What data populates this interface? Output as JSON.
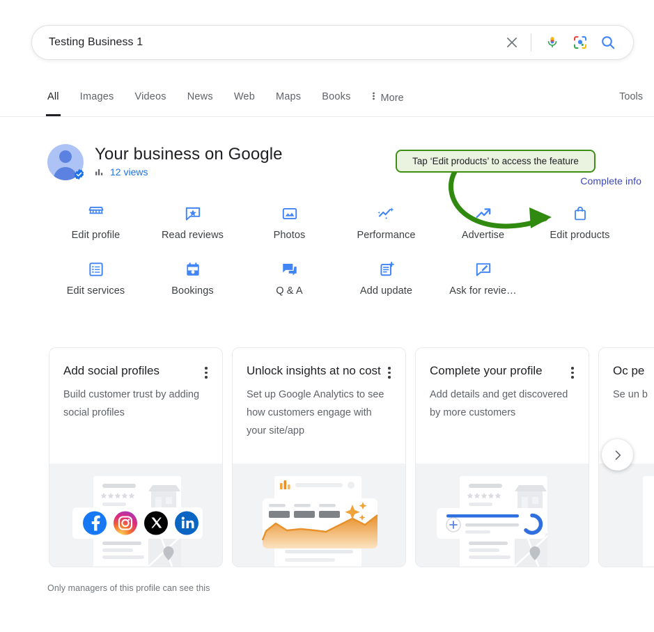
{
  "search": {
    "query": "Testing Business 1",
    "clear_icon": "close-icon",
    "mic_icon": "microphone-icon",
    "lens_icon": "google-lens-icon",
    "search_icon": "search-icon"
  },
  "nav": {
    "items": [
      {
        "label": "All",
        "active": true
      },
      {
        "label": "Images",
        "active": false
      },
      {
        "label": "Videos",
        "active": false
      },
      {
        "label": "News",
        "active": false
      },
      {
        "label": "Web",
        "active": false
      },
      {
        "label": "Maps",
        "active": false
      },
      {
        "label": "Books",
        "active": false
      }
    ],
    "more_label": "More",
    "more_icon": "vertical-dots-icon",
    "tools_label": "Tools"
  },
  "business": {
    "title": "Your business on Google",
    "views_text": "12 views",
    "views_icon": "bar-chart-icon",
    "avatar_icon": "person-avatar",
    "verified_icon": "verified-badge-icon",
    "complete_info_label": "Complete info"
  },
  "callout": {
    "text": "Tap ‘Edit products’ to access the feature",
    "border_color": "#3f8f15",
    "background_color": "#eaf3e0",
    "arrow_color": "#2f8a0f"
  },
  "actions": {
    "row1": [
      {
        "label": "Edit profile",
        "icon": "storefront-icon"
      },
      {
        "label": "Read reviews",
        "icon": "review-star-chat-icon"
      },
      {
        "label": "Photos",
        "icon": "photo-icon"
      },
      {
        "label": "Performance",
        "icon": "trending-sparkle-icon"
      },
      {
        "label": "Advertise",
        "icon": "trending-up-arrow-icon"
      },
      {
        "label": "Edit products",
        "icon": "shopping-bag-icon"
      }
    ],
    "row2": [
      {
        "label": "Edit services",
        "icon": "list-icon"
      },
      {
        "label": "Bookings",
        "icon": "calendar-icon"
      },
      {
        "label": "Q & A",
        "icon": "chat-bubbles-icon"
      },
      {
        "label": "Add update",
        "icon": "add-post-icon"
      },
      {
        "label": "Ask for revie…",
        "icon": "edit-chat-icon"
      }
    ]
  },
  "cards": [
    {
      "title": "Add social profiles",
      "body": "Build customer trust by adding social profiles",
      "kebab_icon": "more-options-icon",
      "image": "social-profiles-illustration",
      "social_icons": [
        "facebook-icon",
        "instagram-icon",
        "x-twitter-icon",
        "linkedin-icon"
      ]
    },
    {
      "title": "Unlock insights at no cost",
      "body": "Set up Google Analytics to see how customers engage with your site/app",
      "kebab_icon": "more-options-icon",
      "image": "analytics-chart-illustration"
    },
    {
      "title": "Complete your profile",
      "body": "Add details and get discovered by more customers",
      "kebab_icon": "more-options-icon",
      "image": "profile-progress-illustration"
    },
    {
      "title": "Oc pe",
      "body": "Se un b",
      "kebab_icon": "more-options-icon",
      "image": "partial-illustration"
    }
  ],
  "carousel": {
    "next_icon": "chevron-right-icon"
  },
  "footer": {
    "note": "Only managers of this profile can see this"
  },
  "colors": {
    "accent_blue": "#1a73e8",
    "icon_blue": "#4285f4",
    "text_primary": "#202124",
    "text_secondary": "#5f6368",
    "green": "#2f8a0f",
    "complete_info": "#3b47b8"
  }
}
